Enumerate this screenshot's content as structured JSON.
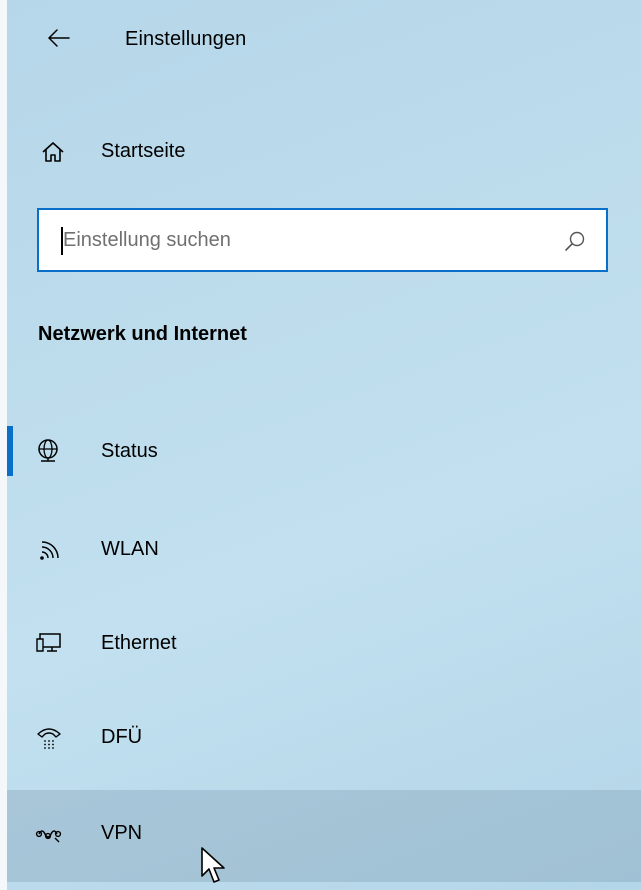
{
  "window": {
    "title": "Einstellungen"
  },
  "home": {
    "label": "Startseite",
    "icon": "home-icon"
  },
  "search": {
    "placeholder": "Einstellung suchen",
    "value": "",
    "icon": "search-icon"
  },
  "section": {
    "heading": "Netzwerk und Internet"
  },
  "nav": {
    "items": [
      {
        "label": "Status",
        "icon": "globe-status-icon",
        "selected": true
      },
      {
        "label": "WLAN",
        "icon": "wifi-icon",
        "selected": false
      },
      {
        "label": "Ethernet",
        "icon": "ethernet-icon",
        "selected": false
      },
      {
        "label": "DFÜ",
        "icon": "dialup-phone-icon",
        "selected": false
      },
      {
        "label": "VPN",
        "icon": "vpn-icon",
        "selected": false,
        "hovered": true
      }
    ]
  },
  "colors": {
    "accent": "#0a6fc9",
    "background": "#bddcec",
    "hover": "#a4c3d3"
  }
}
